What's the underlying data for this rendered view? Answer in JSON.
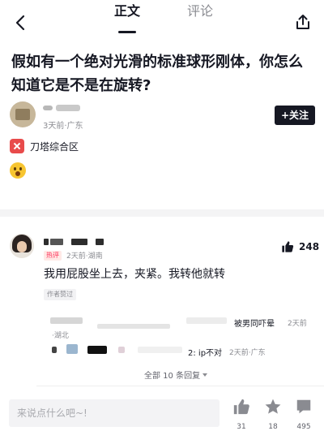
{
  "nav": {
    "tab_active": "正文",
    "tab_inactive": "评论"
  },
  "question": {
    "title": "假如有一个绝对光滑的标准球形刚体，你怎么知道它是不是在旋转?"
  },
  "author": {
    "meta": "3天前·广东",
    "follow_label": "+关注"
  },
  "circle": {
    "label": "刀塔综合区"
  },
  "comment": {
    "badge": "热评",
    "meta": "2天前·湖南",
    "like_count": "248",
    "text": "我用屁股坐上去，夹紧。我转他就转",
    "author_liked": "作者赞过"
  },
  "replies": [
    {
      "text": "被男同吓晕",
      "time": "2天前",
      "location": "·湖北"
    },
    {
      "text": "2: ip不对",
      "time": "2天前·广东"
    }
  ],
  "expand_label": "全部 10 条回复",
  "bottom_bar": {
    "input_placeholder": "来说点什么吧~!",
    "like_count": "31",
    "star_count": "18",
    "comment_count": "495"
  },
  "colors": {
    "accent": "#fe2c55",
    "text": "#161823",
    "muted": "#8a8b91"
  }
}
